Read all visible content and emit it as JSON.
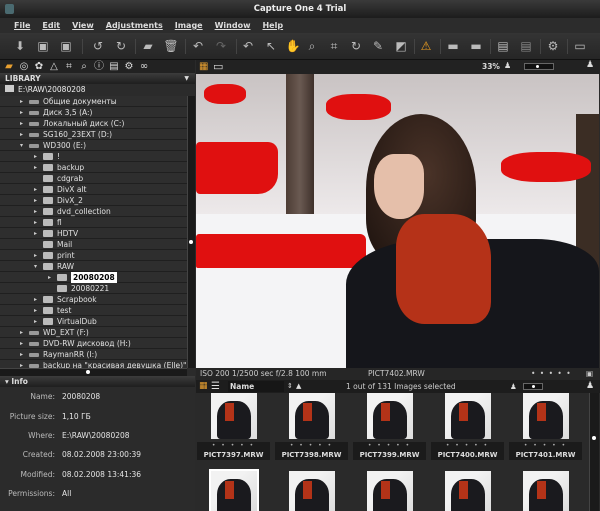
{
  "window": {
    "title": "Capture One 4 Trial"
  },
  "menu": [
    "File",
    "Edit",
    "View",
    "Adjustments",
    "Image",
    "Window",
    "Help"
  ],
  "toolbar": {
    "icons": [
      "import-icon",
      "capture-icon",
      "capture-folder-icon",
      "rotate-left-icon",
      "rotate-right-icon",
      "new-folder-icon",
      "delete-icon",
      "undo-icon",
      "redo-icon",
      "reset-icon",
      "select-cursor-icon",
      "pan-hand-icon",
      "zoom-icon",
      "crop-icon",
      "rotate-tool-icon",
      "color-picker-icon",
      "keystone-icon",
      "warning-icon",
      "process-icon",
      "batch-icon",
      "export-icon",
      "export-variants-icon",
      "settings-icon",
      "fullscreen-icon"
    ]
  },
  "tool_tabs": [
    "library-icon",
    "capture-icon",
    "color-icon",
    "exposure-icon",
    "crop-icon",
    "focus-icon",
    "info-icon",
    "output-icon",
    "settings-icon",
    "batch-icon"
  ],
  "library": {
    "header": "LIBRARY",
    "path": "E:\\RAW\\20080208",
    "tree": [
      {
        "label": "Общие документы",
        "depth": 0,
        "type": "drive",
        "arrow": "▸"
      },
      {
        "label": "Диск 3,5 (A:)",
        "depth": 0,
        "type": "drive",
        "arrow": "▸"
      },
      {
        "label": "Локальный диск (C:)",
        "depth": 0,
        "type": "drive",
        "arrow": "▸"
      },
      {
        "label": "SG160_23EXT (D:)",
        "depth": 0,
        "type": "drive",
        "arrow": "▸"
      },
      {
        "label": "WD300 (E:)",
        "depth": 0,
        "type": "drive",
        "arrow": "▾"
      },
      {
        "label": "!",
        "depth": 1,
        "type": "folder",
        "arrow": "▸"
      },
      {
        "label": "backup",
        "depth": 1,
        "type": "folder",
        "arrow": "▸"
      },
      {
        "label": "cdgrab",
        "depth": 1,
        "type": "folder",
        "arrow": ""
      },
      {
        "label": "DivX alt",
        "depth": 1,
        "type": "folder",
        "arrow": "▸"
      },
      {
        "label": "DivX_2",
        "depth": 1,
        "type": "folder",
        "arrow": "▸"
      },
      {
        "label": "dvd_collection",
        "depth": 1,
        "type": "folder",
        "arrow": "▸"
      },
      {
        "label": "fl",
        "depth": 1,
        "type": "folder",
        "arrow": "▸"
      },
      {
        "label": "HDTV",
        "depth": 1,
        "type": "folder",
        "arrow": "▸"
      },
      {
        "label": "Mail",
        "depth": 1,
        "type": "folder",
        "arrow": ""
      },
      {
        "label": "print",
        "depth": 1,
        "type": "folder",
        "arrow": "▸"
      },
      {
        "label": "RAW",
        "depth": 1,
        "type": "folder",
        "arrow": "▾"
      },
      {
        "label": "20080208",
        "depth": 2,
        "type": "folder",
        "arrow": "▸",
        "selected": true
      },
      {
        "label": "20080221",
        "depth": 2,
        "type": "folder",
        "arrow": ""
      },
      {
        "label": "Scrapbook",
        "depth": 1,
        "type": "folder",
        "arrow": "▸"
      },
      {
        "label": "test",
        "depth": 1,
        "type": "folder",
        "arrow": "▸"
      },
      {
        "label": "VirtualDub",
        "depth": 1,
        "type": "folder",
        "arrow": "▸"
      },
      {
        "label": "WD_EXT (F:)",
        "depth": 0,
        "type": "drive",
        "arrow": "▸"
      },
      {
        "label": "DVD-RW дисковод (H:)",
        "depth": 0,
        "type": "drive",
        "arrow": "▸"
      },
      {
        "label": "RaymanRR (I:)",
        "depth": 0,
        "type": "drive",
        "arrow": "▸"
      },
      {
        "label": "backup на \"красивая девушка (Elle)\" (",
        "depth": 0,
        "type": "drive",
        "arrow": "▸"
      }
    ]
  },
  "info": {
    "header": "Info",
    "fields": [
      {
        "k": "Name:",
        "v": "20080208"
      },
      {
        "k": "Picture size:",
        "v": "1,10 ГБ"
      },
      {
        "k": "Where:",
        "v": "E:\\RAW\\20080208"
      },
      {
        "k": "Created:",
        "v": "08.02.2008 23:00:39"
      },
      {
        "k": "Modified:",
        "v": "08.02.2008 13:41:36"
      },
      {
        "k": "Permissions:",
        "v": "All"
      }
    ]
  },
  "viewer": {
    "zoom": "33%",
    "exif": "ISO 200  1/2500 sec  f/2.8  100 mm",
    "filename": "PICT7402.MRW",
    "stars": "• • • • •"
  },
  "browser": {
    "sort": "Name",
    "selection": "1 out of 131 Images selected",
    "thumbs": [
      {
        "name": "PICT7397.MRW"
      },
      {
        "name": "PICT7398.MRW"
      },
      {
        "name": "PICT7399.MRW"
      },
      {
        "name": "PICT7400.MRW"
      },
      {
        "name": "PICT7401.MRW"
      },
      {
        "name": ""
      },
      {
        "name": ""
      },
      {
        "name": ""
      },
      {
        "name": ""
      },
      {
        "name": ""
      }
    ],
    "stars": "• • • • •"
  },
  "colors": {
    "accent": "#e8a030",
    "highlight_warning": "#e01010",
    "background": "#2a2a2a"
  }
}
